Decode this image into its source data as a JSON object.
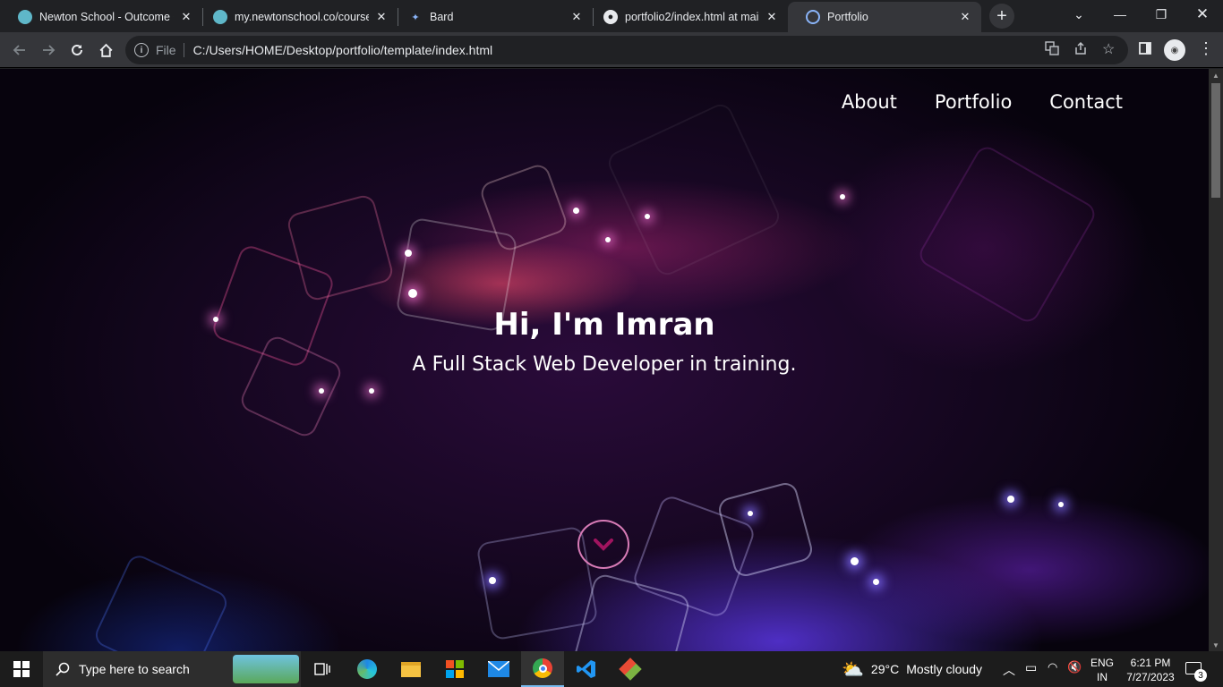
{
  "browser": {
    "tabs": [
      {
        "title": "Newton School - Outcome O",
        "favicon": "newton-school-icon",
        "active": false
      },
      {
        "title": "my.newtonschool.co/course/",
        "favicon": "newton-school-icon",
        "active": false
      },
      {
        "title": "Bard",
        "favicon": "bard-sparkle-icon",
        "active": false
      },
      {
        "title": "portfolio2/index.html at main",
        "favicon": "github-icon",
        "active": false
      },
      {
        "title": "Portfolio",
        "favicon": "globe-icon",
        "active": true
      }
    ],
    "address": {
      "scheme": "File",
      "url": "C:/Users/HOME/Desktop/portfolio/template/index.html"
    }
  },
  "page": {
    "nav": [
      "About",
      "Portfolio",
      "Contact"
    ],
    "hero_title": "Hi, I'm Imran",
    "hero_subtitle": "A Full Stack Web Developer in training.",
    "accent_color": "#d77bb6",
    "chevron_color": "#a0145f"
  },
  "taskbar": {
    "search_placeholder": "Type here to search",
    "weather_temp": "29°C",
    "weather_desc": "Mostly cloudy",
    "language": "ENG",
    "region": "IN",
    "time": "6:21 PM",
    "date": "7/27/2023",
    "notifications": "3"
  }
}
